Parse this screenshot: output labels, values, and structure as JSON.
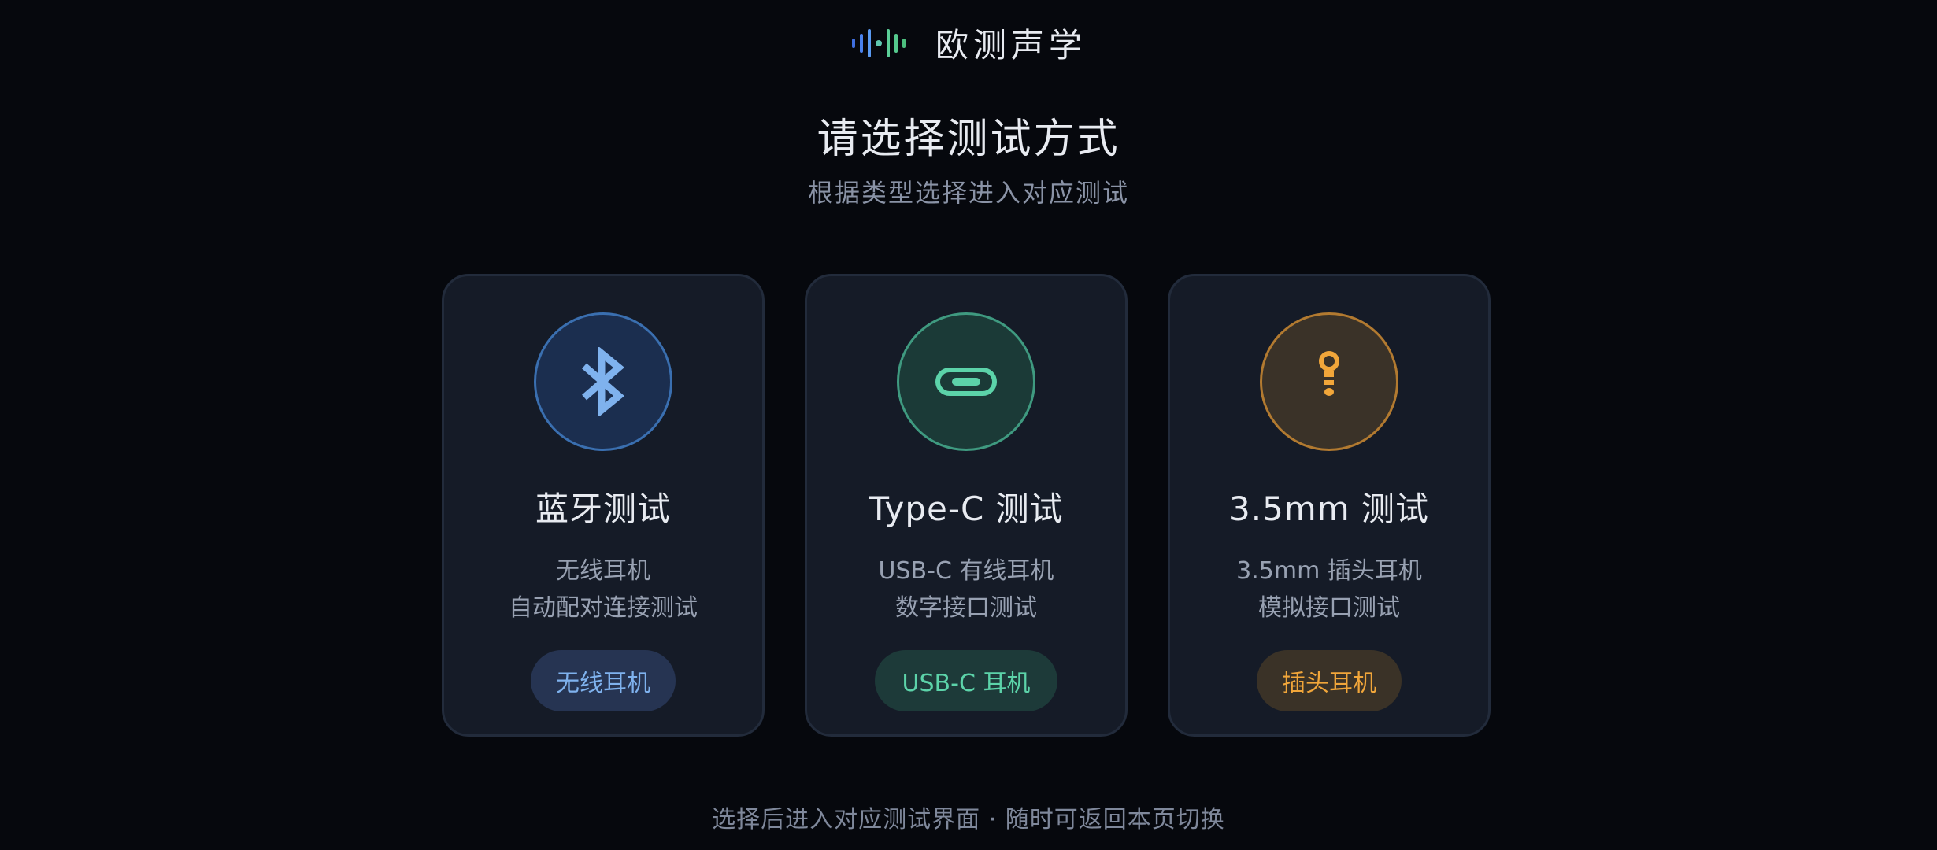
{
  "brand": {
    "name": "欧测声学",
    "logo_icon": "sound-wave-icon",
    "logo_colors": [
      "#3f6fe0",
      "#4e8cf0",
      "#5fb8c9",
      "#5bcf98",
      "#59d38f",
      "#4cbf7e"
    ]
  },
  "page": {
    "title": "请选择测试方式",
    "subtitle": "根据类型选择进入对应测试"
  },
  "cards": [
    {
      "id": "bluetooth",
      "icon": "bluetooth-icon",
      "title": "蓝牙测试",
      "desc_line1": "无线耳机",
      "desc_line2": "自动配对连接测试",
      "tag": "无线耳机",
      "accent": "#7fb2ee"
    },
    {
      "id": "typec",
      "icon": "usb-c-icon",
      "title": "Type-C 测试",
      "desc_line1": "USB-C 有线耳机",
      "desc_line2": "数字接口测试",
      "tag": "USB-C 耳机",
      "accent": "#5cd3a9"
    },
    {
      "id": "jack",
      "icon": "audio-jack-icon",
      "title": "3.5mm 测试",
      "desc_line1": "3.5mm 插头耳机",
      "desc_line2": "模拟接口测试",
      "tag": "插头耳机",
      "accent": "#f1a63a"
    }
  ],
  "footer": {
    "hint": "选择后进入对应测试界面 · 随时可返回本页切换"
  }
}
